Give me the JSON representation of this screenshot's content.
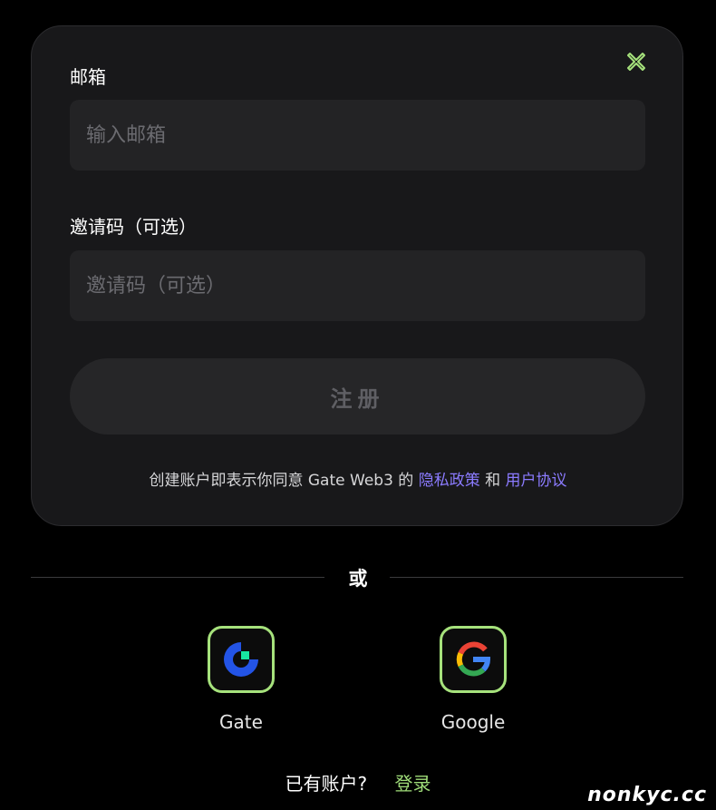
{
  "form": {
    "email_label": "邮箱",
    "email_placeholder": "输入邮箱",
    "invite_label": "邀请码（可选）",
    "invite_placeholder": "邀请码（可选）",
    "register_label": "注册",
    "terms_prefix": "创建账户即表示你同意 Gate Web3 的",
    "privacy_link": "隐私政策",
    "terms_and": "和",
    "user_agreement_link": "用户协议"
  },
  "divider": {
    "or_label": "或"
  },
  "social": {
    "gate_label": "Gate",
    "google_label": "Google"
  },
  "footer": {
    "have_account": "已有账户?",
    "login_link": "登录"
  },
  "watermark": "nonkyc.cc",
  "colors": {
    "accent_green": "#a6e27c",
    "link_purple": "#8b7bff",
    "gate_blue": "#2354e6",
    "gate_green": "#17e6a1"
  }
}
